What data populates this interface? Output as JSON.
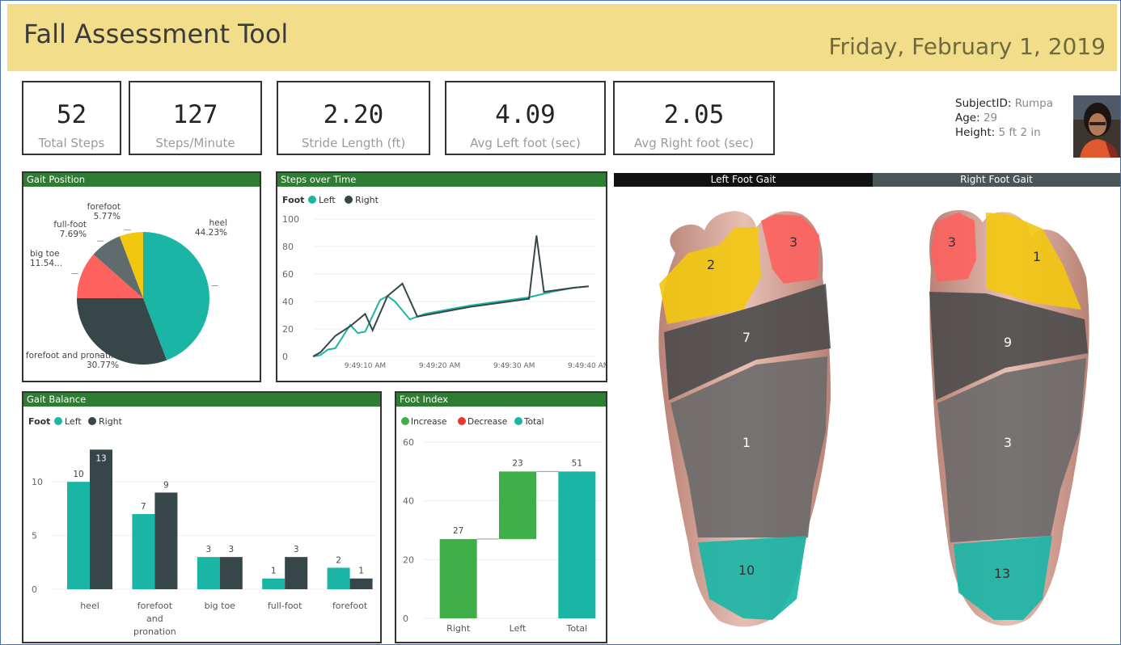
{
  "header": {
    "title": "Fall Assessment Tool",
    "date": "Friday, February 1, 2019"
  },
  "kpis": [
    {
      "value": "52",
      "label": "Total Steps"
    },
    {
      "value": "127",
      "label": "Steps/Minute"
    },
    {
      "value": "2.20",
      "label": "Stride Length (ft)"
    },
    {
      "value": "4.09",
      "label": "Avg Left foot (sec)"
    },
    {
      "value": "2.05",
      "label": "Avg Right foot (sec)"
    }
  ],
  "subject": {
    "id_label": "SubjectID:",
    "id_value": "Rumpa",
    "age_label": "Age:",
    "age_value": "29",
    "height_label": "Height:",
    "height_value": "5 ft 2 in"
  },
  "colors": {
    "teal": "#1bb5a6",
    "dark": "#374649",
    "salmon": "#fd625e",
    "gray": "#5f6b6d",
    "yellow": "#f2c80f",
    "green": "#3fae49",
    "red": "#e23a33",
    "header_green": "#2e7d32"
  },
  "panels": {
    "gait_position": {
      "title": "Gait Position"
    },
    "steps_over_time": {
      "title": "Steps over Time",
      "legend_title": "Foot",
      "legend": [
        "Left",
        "Right"
      ]
    },
    "gait_balance": {
      "title": "Gait Balance",
      "legend_title": "Foot",
      "legend": [
        "Left",
        "Right"
      ]
    },
    "foot_index": {
      "title": "Foot Index",
      "legend": [
        "Increase",
        "Decrease",
        "Total"
      ]
    }
  },
  "gait_heads": {
    "left": "Left Foot Gait",
    "right": "Right Foot Gait"
  },
  "foot_zones": {
    "left": {
      "toes": "2",
      "big_toe": "3",
      "forefoot": "7",
      "midfoot": "1",
      "heel": "10"
    },
    "right": {
      "toes": "1",
      "big_toe": "3",
      "forefoot": "9",
      "midfoot": "3",
      "heel": "13"
    }
  },
  "chart_data": [
    {
      "type": "pie",
      "title": "Gait Position",
      "slices": [
        {
          "label": "heel",
          "value": 44.23,
          "display": "44.23%",
          "color": "#1bb5a6"
        },
        {
          "label": "forefoot and pronati...",
          "value": 30.77,
          "display": "30.77%",
          "color": "#374649"
        },
        {
          "label": "big toe",
          "value": 11.54,
          "display": "11.54...",
          "color": "#fd625e"
        },
        {
          "label": "full-foot",
          "value": 7.69,
          "display": "7.69%",
          "color": "#5f6b6d"
        },
        {
          "label": "forefoot",
          "value": 5.77,
          "display": "5.77%",
          "color": "#f2c80f"
        }
      ]
    },
    {
      "type": "line",
      "title": "Steps over Time",
      "ylim": [
        0,
        100
      ],
      "yticks": [
        "0",
        "20",
        "40",
        "60",
        "80",
        "100"
      ],
      "x_range": [
        "9:49:03",
        "9:49:41"
      ],
      "xticks": [
        "9:49:10 AM",
        "9:49:20 AM",
        "9:49:30 AM",
        "9:49:40 AM"
      ],
      "series": [
        {
          "name": "Left",
          "color": "#1bb5a6",
          "points": [
            [
              "9:49:03",
              0
            ],
            [
              "9:49:04",
              1
            ],
            [
              "9:49:05",
              5
            ],
            [
              "9:49:06",
              6
            ],
            [
              "9:49:08",
              23
            ],
            [
              "9:49:09",
              17
            ],
            [
              "9:49:10",
              18
            ],
            [
              "9:49:12",
              41
            ],
            [
              "9:49:13",
              44
            ],
            [
              "9:49:14",
              40
            ],
            [
              "9:49:16",
              27
            ],
            [
              "9:49:18",
              31
            ],
            [
              "9:49:20",
              33
            ],
            [
              "9:49:24",
              37
            ],
            [
              "9:49:28",
              40
            ],
            [
              "9:49:32",
              43
            ],
            [
              "9:49:35",
              47
            ],
            [
              "9:49:38",
              50
            ],
            [
              "9:49:40",
              51
            ]
          ]
        },
        {
          "name": "Right",
          "color": "#374649",
          "points": [
            [
              "9:49:03",
              0
            ],
            [
              "9:49:04",
              3
            ],
            [
              "9:49:06",
              15
            ],
            [
              "9:49:08",
              22
            ],
            [
              "9:49:10",
              31
            ],
            [
              "9:49:11",
              19
            ],
            [
              "9:49:13",
              44
            ],
            [
              "9:49:15",
              53
            ],
            [
              "9:49:17",
              29
            ],
            [
              "9:49:20",
              32
            ],
            [
              "9:49:24",
              36
            ],
            [
              "9:49:28",
              39
            ],
            [
              "9:49:32",
              42
            ],
            [
              "9:49:33",
              88
            ],
            [
              "9:49:34",
              47
            ],
            [
              "9:49:38",
              50
            ],
            [
              "9:49:40",
              51
            ]
          ]
        }
      ]
    },
    {
      "type": "bar",
      "title": "Gait Balance",
      "categories": [
        [
          "heel"
        ],
        [
          "forefoot",
          "and",
          "pronation"
        ],
        [
          "big toe"
        ],
        [
          "full-foot"
        ],
        [
          "forefoot"
        ]
      ],
      "ylim": [
        0,
        14
      ],
      "yticks": [
        "0",
        "5",
        "10"
      ],
      "series": [
        {
          "name": "Left",
          "color": "#1bb5a6",
          "values": [
            10,
            7,
            3,
            1,
            2
          ]
        },
        {
          "name": "Right",
          "color": "#374649",
          "values": [
            13,
            9,
            3,
            3,
            1
          ]
        }
      ]
    },
    {
      "type": "bar",
      "title": "Foot Index",
      "subtype": "waterfall",
      "categories": [
        "Right",
        "Left",
        "Total"
      ],
      "ylim": [
        0,
        60
      ],
      "yticks": [
        "0",
        "20",
        "40",
        "60"
      ],
      "bars": [
        {
          "label": "Right",
          "start": 0,
          "end": 27,
          "display": "27",
          "kind": "Increase",
          "color": "#3fae49"
        },
        {
          "label": "Left",
          "start": 27,
          "end": 50,
          "display": "23",
          "kind": "Increase",
          "color": "#3fae49"
        },
        {
          "label": "Total",
          "start": 0,
          "end": 50,
          "display": "51",
          "kind": "Total",
          "color": "#1bb5a6"
        }
      ]
    }
  ]
}
